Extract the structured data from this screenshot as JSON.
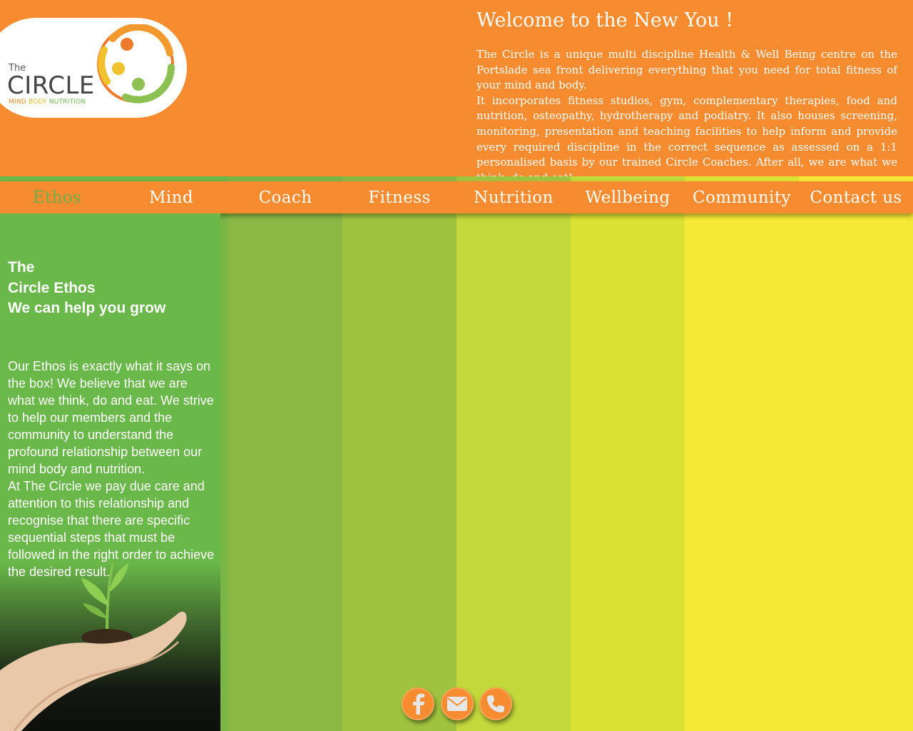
{
  "colors": {
    "orange": "#f68b2f",
    "stripes": [
      "#6ab74a",
      "#7ab645",
      "#8bb845",
      "#a0c33f",
      "#c2d83b",
      "#dbe233",
      "#f6e935",
      "#f6e935"
    ],
    "nav_active": "#6db04a"
  },
  "logo": {
    "the": "The",
    "name": "CIRCLE",
    "tagline_parts": [
      "MIND",
      "BODY",
      "NUTRITION"
    ]
  },
  "header": {
    "title": "Welcome to the New You !",
    "paragraph1": "The Circle is a unique multi discipline Health & Well Being centre on the Portslade sea front delivering everything that you need for total fitness of your mind and body.",
    "paragraph2": "It incorporates fitness studios, gym, complementary therapies, food and nutrition, osteopathy, hydrotherapy and podiatry. It also houses screening, monitoring, presentation and teaching facilities to help inform and provide every required discipline in the correct sequence as assessed on a 1:1 personalised basis by our trained Circle Coaches. After all, we are what we think, do and eat!"
  },
  "nav": {
    "items": [
      "Ethos",
      "Mind",
      "Coach",
      "Fitness",
      "Nutrition",
      "Wellbeing",
      "Community",
      "Contact us"
    ],
    "active": "Ethos"
  },
  "ethos": {
    "title_line1": "The",
    "title_line2": "Circle Ethos",
    "title_line3": "We can help you grow",
    "body1": "Our Ethos is exactly what it says on the box! We believe that we are what we think, do and eat. We strive to help our members and the community to understand the profound relationship between our mind body and nutrition.",
    "body2": "At The Circle we pay due care and attention to this relationship and recognise that there are specific sequential steps that must be followed in the right order to achieve the desired result."
  },
  "social": {
    "icons": [
      "facebook-icon",
      "email-icon",
      "phone-icon"
    ]
  }
}
